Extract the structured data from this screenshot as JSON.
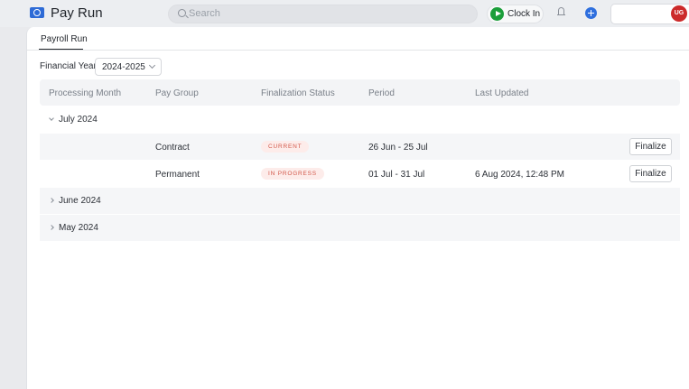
{
  "app": {
    "title": "Pay Run",
    "logo_icon": "money-icon"
  },
  "search": {
    "placeholder": "Search"
  },
  "header": {
    "clock_in_label": "Clock In",
    "avatar_initials": "UG"
  },
  "tabs": [
    {
      "label": "Payroll Run"
    }
  ],
  "filter": {
    "label": "Financial Year",
    "value": "2024-2025"
  },
  "table": {
    "columns": [
      "Processing Month",
      "Pay Group",
      "Finalization Status",
      "Period",
      "Last Updated"
    ],
    "groups": [
      {
        "month": "July 2024",
        "expanded": true,
        "rows": [
          {
            "pay_group": "Contract",
            "status": "CURRENT",
            "period": "26 Jun - 25 Jul",
            "last_updated": "",
            "action": "Finalize"
          },
          {
            "pay_group": "Permanent",
            "status": "IN PROGRESS",
            "period": "01 Jul - 31 Jul",
            "last_updated": "6 Aug 2024, 12:48 PM",
            "action": "Finalize"
          }
        ]
      },
      {
        "month": "June 2024",
        "expanded": false,
        "rows": []
      },
      {
        "month": "May 2024",
        "expanded": false,
        "rows": []
      }
    ]
  },
  "colors": {
    "accent": "#2f6fde",
    "clock_in_green": "#1b9e3a",
    "avatar_red": "#cc2a2a",
    "status_text": "#d2584a",
    "status_bg": "#fdecea"
  }
}
